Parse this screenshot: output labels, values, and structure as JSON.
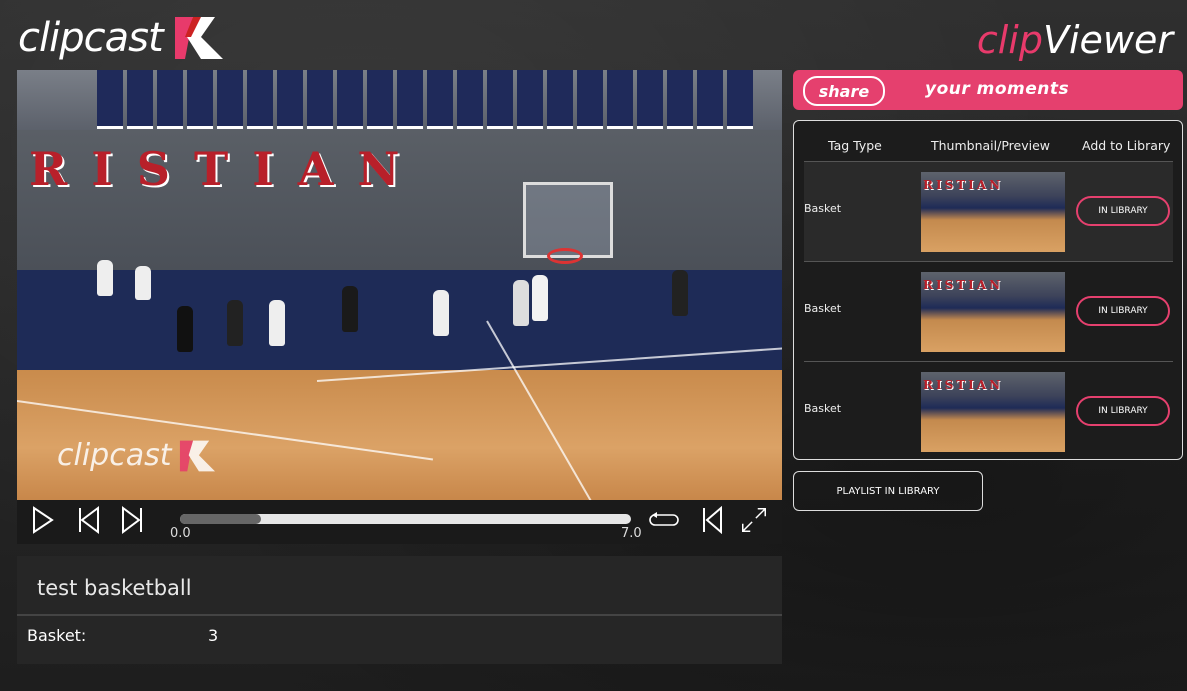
{
  "header": {
    "logo_text": "clipcast",
    "viewer_clip": "clip",
    "viewer_rest": "Viewer"
  },
  "player": {
    "watermark_text": "clipcast",
    "court_text": "RISTIAN",
    "time_start": "0.0",
    "time_end": "7.0",
    "progress": 0.18
  },
  "clip": {
    "title": "test basketball",
    "tag_label": "Basket:",
    "tag_count": "3"
  },
  "share": {
    "share_label": "share",
    "moments_label": "your moments"
  },
  "table": {
    "headers": [
      "Tag Type",
      "Thumbnail/Preview",
      "Add to Library"
    ],
    "rows": [
      {
        "tag": "Basket",
        "status": "IN LIBRARY"
      },
      {
        "tag": "Basket",
        "status": "IN LIBRARY"
      },
      {
        "tag": "Basket",
        "status": "IN LIBRARY"
      }
    ]
  },
  "playlist_label": "PLAYLIST IN LIBRARY",
  "colors": {
    "accent": "#e5406e",
    "panel": "#262626"
  }
}
